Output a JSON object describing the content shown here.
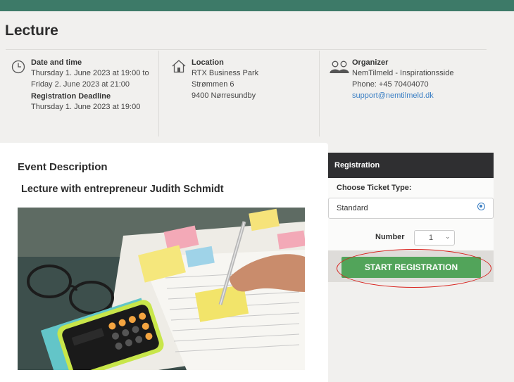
{
  "header": {
    "title": "Lecture"
  },
  "info": {
    "date": {
      "heading": "Date and time",
      "line1": "Thursday 1. June 2023 at 19:00 to",
      "line2": "Friday 2. June 2023 at 21:00",
      "deadline_heading": "Registration Deadline",
      "deadline": "Thursday 1. June 2023 at 19:00",
      "icon": "clock-icon"
    },
    "location": {
      "heading": "Location",
      "line1": "RTX Business Park",
      "line2": "Strømmen 6",
      "line3": "9400 Nørresundby",
      "icon": "house-icon"
    },
    "organizer": {
      "heading": "Organizer",
      "name": "NemTilmeld - Inspirationsside",
      "phone": "Phone: +45 70404070",
      "email": "support@nemtilmeld.dk",
      "icon": "people-icon"
    }
  },
  "description": {
    "title": "Event Description",
    "subtitle": "Lecture with entrepreneur Judith Schmidt"
  },
  "registration": {
    "header": "Registration",
    "ticket_label": "Choose Ticket Type:",
    "ticket_name": "Standard",
    "number_label": "Number",
    "quantity": "1",
    "button_label": "START REGISTRATION"
  },
  "colors": {
    "topbar": "#3d7a68",
    "button": "#52a45a",
    "registration_header": "#2f2f31",
    "link": "#3b7fc4",
    "annotation": "#d8201b"
  }
}
